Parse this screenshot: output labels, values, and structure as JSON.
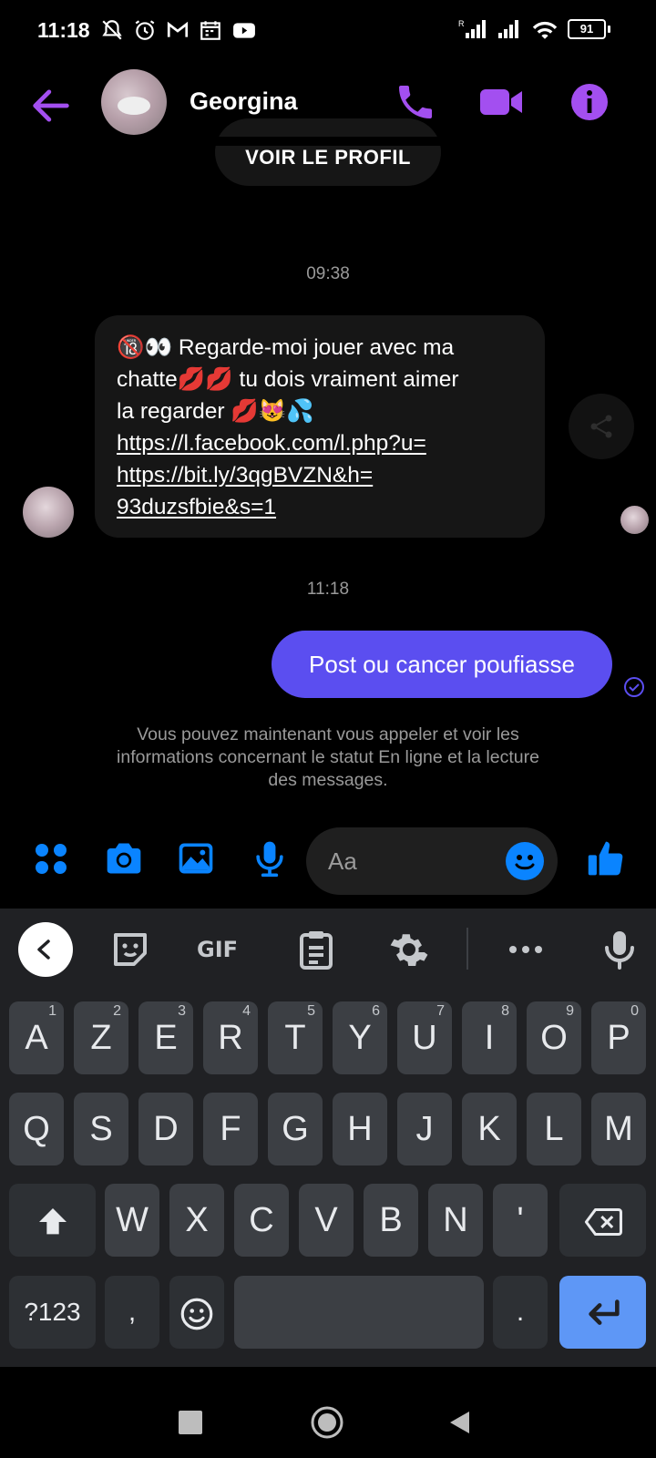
{
  "status_bar": {
    "time": "11:18",
    "battery": "91"
  },
  "header": {
    "name": "Georgina"
  },
  "profile_button": "VOIR LE PROFIL",
  "messages": {
    "time_1": "09:38",
    "incoming_lines": [
      "🔞👀 Regarde-moi jouer avec ma",
      "chatte💋💋 tu dois vraiment aimer",
      "la regarder 💋😻💦"
    ],
    "incoming_link_lines": [
      "https://l.facebook.com/l.php?u=",
      "https://bit.ly/3qgBVZN&h=",
      "93duzsfbie&s=1"
    ],
    "time_2": "11:18",
    "outgoing": "Post ou cancer poufiasse",
    "info": "Vous pouvez maintenant vous appeler et voir les informations concernant le statut En ligne et la lecture des messages."
  },
  "composer": {
    "placeholder": "Aa"
  },
  "keyboard": {
    "toolbar_gif": "GIF",
    "row1": [
      {
        "label": "A",
        "hint": "1"
      },
      {
        "label": "Z",
        "hint": "2"
      },
      {
        "label": "E",
        "hint": "3"
      },
      {
        "label": "R",
        "hint": "4"
      },
      {
        "label": "T",
        "hint": "5"
      },
      {
        "label": "Y",
        "hint": "6"
      },
      {
        "label": "U",
        "hint": "7"
      },
      {
        "label": "I",
        "hint": "8"
      },
      {
        "label": "O",
        "hint": "9"
      },
      {
        "label": "P",
        "hint": "0"
      }
    ],
    "row2": [
      "Q",
      "S",
      "D",
      "F",
      "G",
      "H",
      "J",
      "K",
      "L",
      "M"
    ],
    "row3": [
      "W",
      "X",
      "C",
      "V",
      "B",
      "N",
      "'"
    ],
    "row4": {
      "symbols": "?123",
      "comma": ",",
      "period": "."
    }
  },
  "colors": {
    "accent_purple": "#a34ff0",
    "bubble_blue": "#5b4ef0",
    "messenger_blue": "#0a84ff",
    "enter_blue": "#5e97f6"
  }
}
